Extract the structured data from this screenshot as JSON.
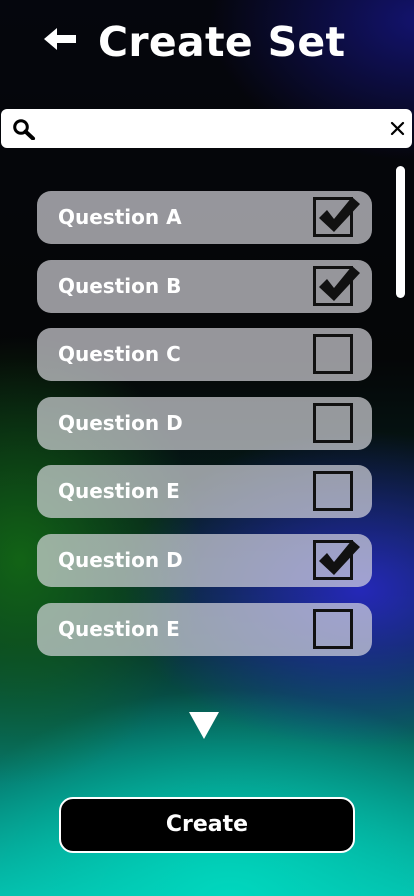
{
  "header": {
    "title": "Create Set",
    "back_icon": "arrow-left-icon"
  },
  "search": {
    "value": "",
    "placeholder": "",
    "search_icon": "search-icon",
    "clear_icon": "close-icon"
  },
  "questions": [
    {
      "label": "Question A",
      "checked": true
    },
    {
      "label": "Question B",
      "checked": true
    },
    {
      "label": "Question C",
      "checked": false
    },
    {
      "label": "Question D",
      "checked": false
    },
    {
      "label": "Question E",
      "checked": false
    },
    {
      "label": "Question D",
      "checked": true
    },
    {
      "label": "Question E",
      "checked": false
    }
  ],
  "scroll_down_icon": "triangle-down-icon",
  "create_button": {
    "label": "Create"
  }
}
